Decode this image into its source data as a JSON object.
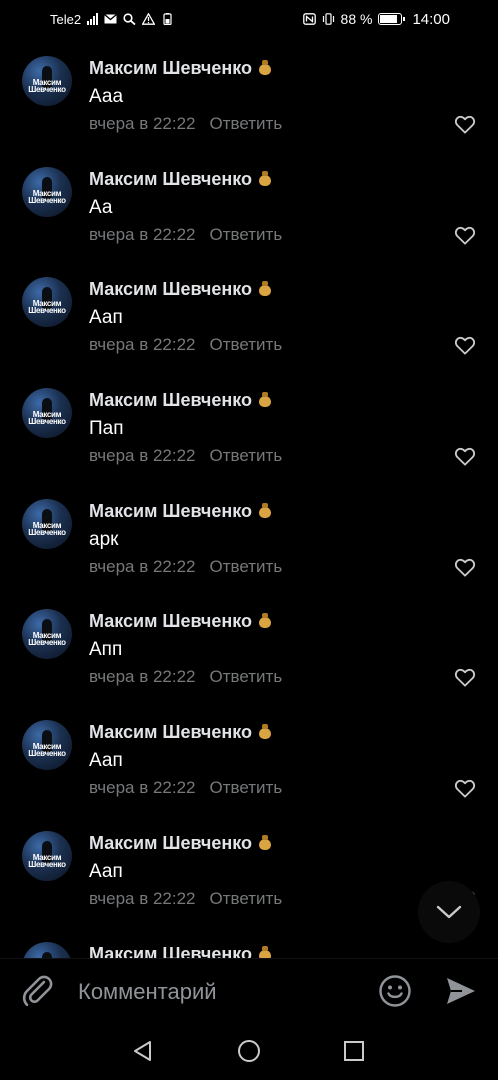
{
  "status_bar": {
    "carrier": "Tele2",
    "battery_text": "88 %",
    "battery_level": 0.88,
    "time": "14:00"
  },
  "comments": [
    {
      "author": "Максим Шевченко",
      "text": "Ааа",
      "time": "вчера в 22:22",
      "reply": "Ответить",
      "avatar_text": "Максим Шевченко"
    },
    {
      "author": "Максим Шевченко",
      "text": "Аа",
      "time": "вчера в 22:22",
      "reply": "Ответить",
      "avatar_text": "Максим Шевченко"
    },
    {
      "author": "Максим Шевченко",
      "text": "Аап",
      "time": "вчера в 22:22",
      "reply": "Ответить",
      "avatar_text": "Максим Шевченко"
    },
    {
      "author": "Максим Шевченко",
      "text": "Пап",
      "time": "вчера в 22:22",
      "reply": "Ответить",
      "avatar_text": "Максим Шевченко"
    },
    {
      "author": "Максим Шевченко",
      "text": "арк",
      "time": "вчера в 22:22",
      "reply": "Ответить",
      "avatar_text": "Максим Шевченко"
    },
    {
      "author": "Максим Шевченко",
      "text": "Апп",
      "time": "вчера в 22:22",
      "reply": "Ответить",
      "avatar_text": "Максим Шевченко"
    },
    {
      "author": "Максим Шевченко",
      "text": "Аап",
      "time": "вчера в 22:22",
      "reply": "Ответить",
      "avatar_text": "Максим Шевченко"
    },
    {
      "author": "Максим Шевченко",
      "text": "Аап",
      "time": "вчера в 22:22",
      "reply": "Ответить",
      "avatar_text": "Максим Шевченко"
    },
    {
      "author": "Максим Шевченко",
      "text": "",
      "time": "",
      "reply": "",
      "avatar_text": "Максим Шевченко"
    }
  ],
  "composer": {
    "placeholder": "Комментарий"
  },
  "icons": {
    "author_badge": "money-bag-icon",
    "like": "heart-outline-icon",
    "attach": "paperclip-icon",
    "emoji": "smiley-icon",
    "send": "send-icon",
    "scroll_down": "chevron-down-icon"
  },
  "colors": {
    "background": "#000000",
    "text_primary": "#e1e3e6",
    "text_secondary": "#76787a",
    "badge": "#d9a441"
  }
}
